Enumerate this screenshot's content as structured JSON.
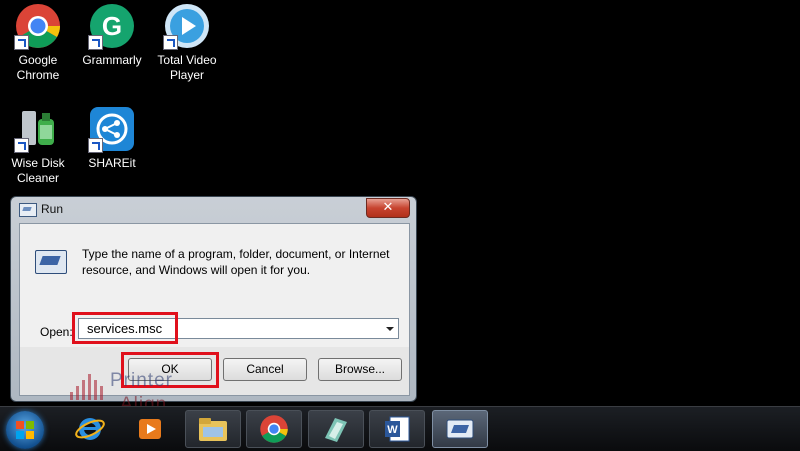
{
  "desktop": {
    "icons": [
      {
        "label_line1": "Google",
        "label_line2": "Chrome",
        "icon": "chrome-icon"
      },
      {
        "label_line1": "Grammarly",
        "label_line2": "",
        "icon": "grammarly-icon"
      },
      {
        "label_line1": "Total Video",
        "label_line2": "Player",
        "icon": "total-video-player-icon"
      },
      {
        "label_line1": "Wise Disk",
        "label_line2": "Cleaner",
        "icon": "wise-disk-cleaner-icon"
      },
      {
        "label_line1": "SHAREit",
        "label_line2": "",
        "icon": "shareit-icon"
      }
    ]
  },
  "run_dialog": {
    "title": "Run",
    "close_label": "✕",
    "description": "Type the name of a program, folder, document, or Internet resource, and Windows will open it for you.",
    "open_label": "Open:",
    "open_value": "services.msc",
    "buttons": {
      "ok": "OK",
      "cancel": "Cancel",
      "browse": "Browse..."
    }
  },
  "watermark": {
    "line1": "Printer",
    "line2": "Align"
  },
  "taskbar": {
    "items": [
      {
        "icon": "start-button-icon"
      },
      {
        "icon": "internet-explorer-icon"
      },
      {
        "icon": "media-player-icon"
      },
      {
        "icon": "file-explorer-icon"
      },
      {
        "icon": "chrome-icon"
      },
      {
        "icon": "app-icon"
      },
      {
        "icon": "word-icon"
      },
      {
        "icon": "run-icon"
      }
    ]
  },
  "colors": {
    "highlight": "#e0101c",
    "desktop": "#000000"
  }
}
